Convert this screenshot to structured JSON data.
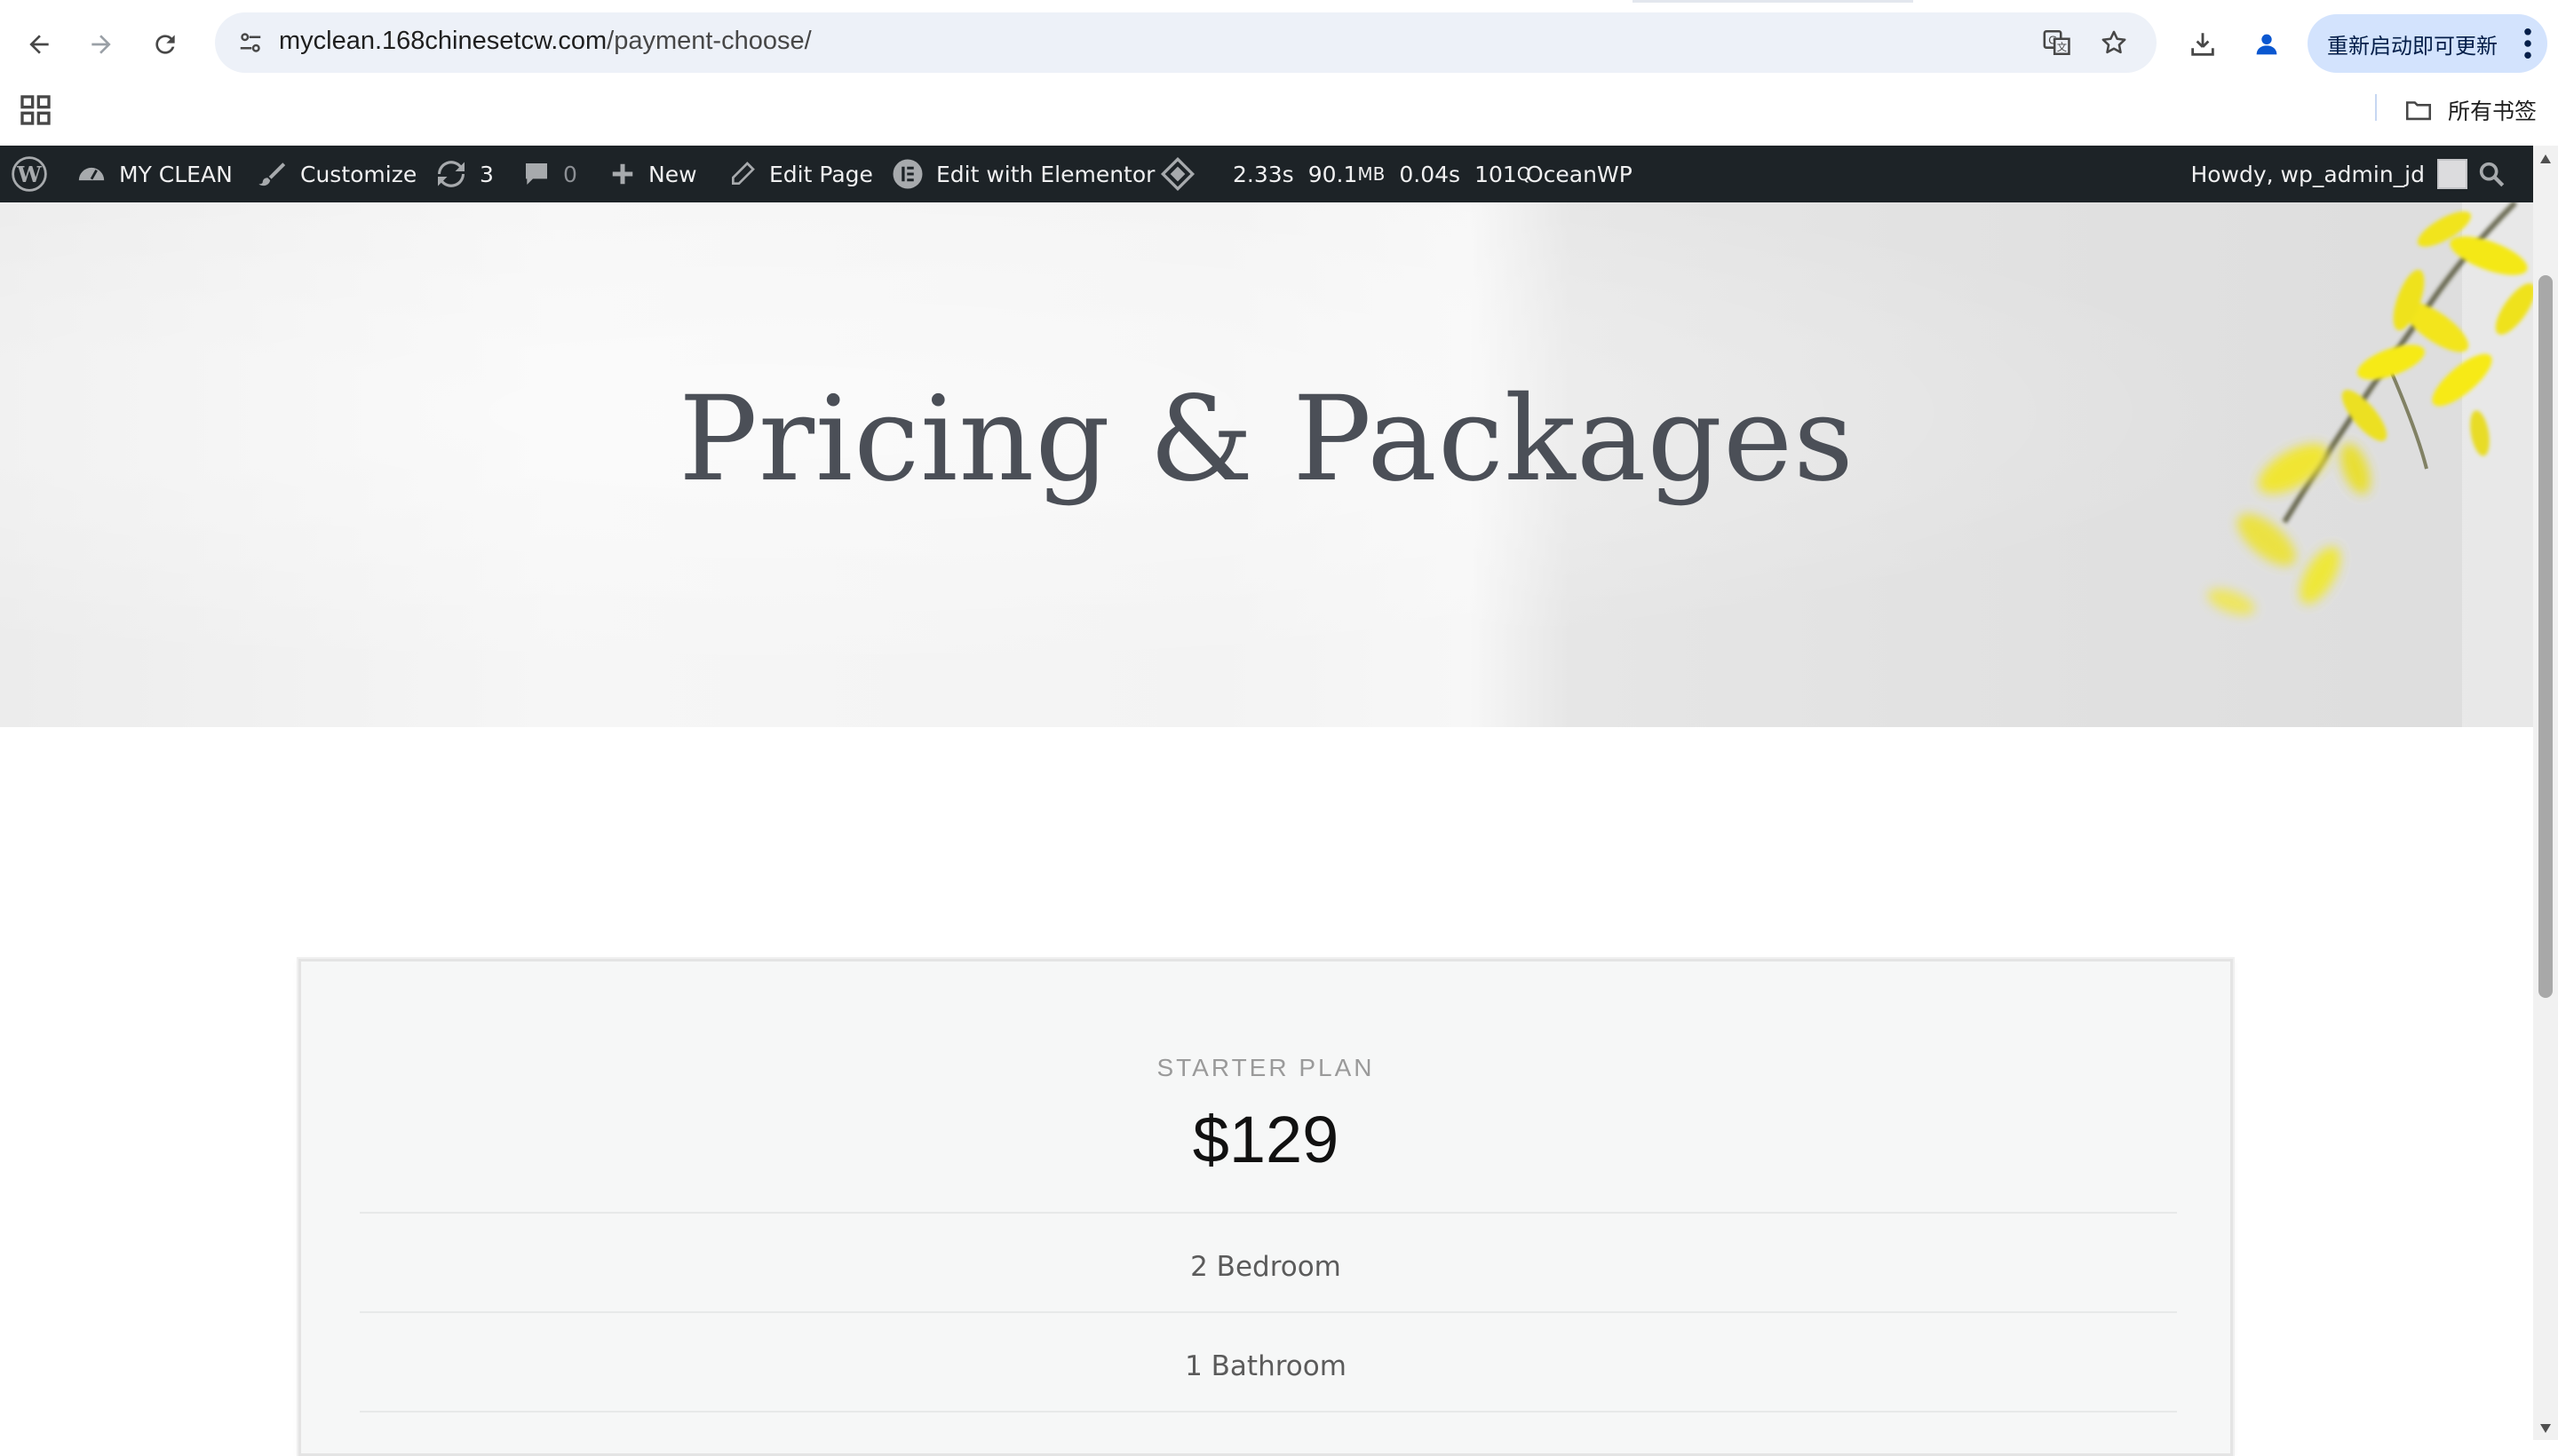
{
  "browser": {
    "url_host": "myclean.168chinesetcw.com",
    "url_path": "/payment-choose/",
    "update_label": "重新启动即可更新",
    "all_bookmarks_label": "所有书签"
  },
  "adminbar": {
    "site_name": "MY CLEAN",
    "customize": "Customize",
    "updates_count": "3",
    "comments_count": "0",
    "new_label": "New",
    "edit_page": "Edit Page",
    "edit_elementor": "Edit with Elementor",
    "qm_time": "2.33s",
    "qm_memory": "90.1",
    "qm_memory_unit": "MB",
    "qm_db_time": "0.04s",
    "qm_queries": "101",
    "qm_queries_unit": "Q",
    "theme": "OceanWP",
    "howdy": "Howdy, wp_admin_jd"
  },
  "hero": {
    "title": "Pricing & Packages"
  },
  "pricing": {
    "plan_name": "STARTER PLAN",
    "price": "$129",
    "features": [
      "2 Bedroom",
      "1 Bathroom"
    ]
  },
  "colors": {
    "adminbar_bg": "#1d2327",
    "omnibox_bg": "#edf1f8",
    "update_pill_bg": "#d3e3fd",
    "hero_title": "#4b4f57",
    "card_bg": "#f6f7f7"
  }
}
